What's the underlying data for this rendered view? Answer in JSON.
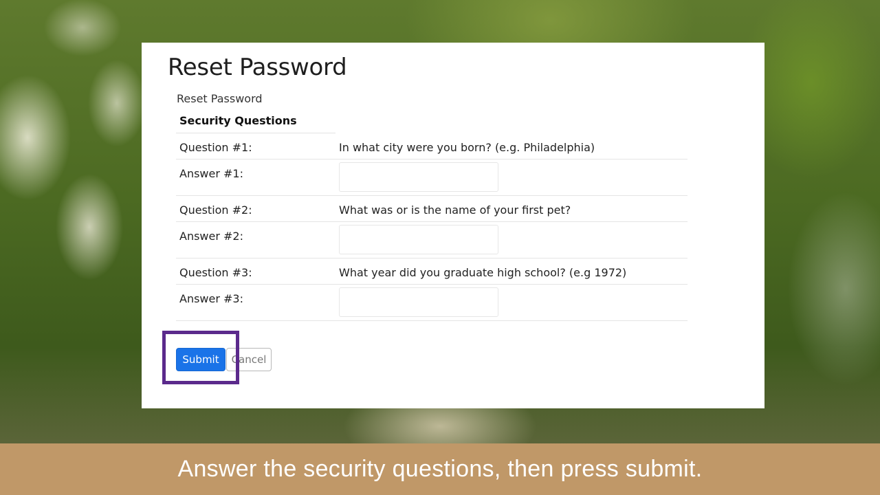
{
  "dialog": {
    "title": "Reset Password",
    "breadcrumb": "Reset Password",
    "section_title": "Security Questions",
    "questions": [
      {
        "question_label": "Question #1:",
        "question_text": "In what city were you born? (e.g. Philadelphia)",
        "answer_label": "Answer #1:",
        "answer_value": ""
      },
      {
        "question_label": "Question #2:",
        "question_text": "What was or is the name of your first pet?",
        "answer_label": "Answer #2:",
        "answer_value": ""
      },
      {
        "question_label": "Question #3:",
        "question_text": "What year did you graduate high school? (e.g 1972)",
        "answer_label": "Answer #3:",
        "answer_value": ""
      }
    ],
    "submit_label": "Submit",
    "cancel_label": "Cancel"
  },
  "caption": "Answer the security questions, then press submit.",
  "colors": {
    "submit_bg": "#1a73e8",
    "highlight": "#5b2a8c",
    "caption_bg": "#c09868"
  }
}
